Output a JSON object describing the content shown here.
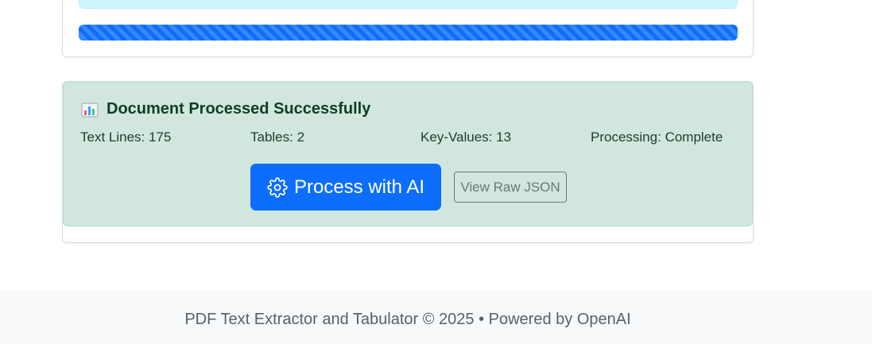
{
  "progress": {
    "percent": 100,
    "color": "#0d6efd"
  },
  "result": {
    "title_icon": "bar-chart-icon",
    "title": "Document Processed Successfully",
    "stats": [
      {
        "key": "Text Lines",
        "value": "175"
      },
      {
        "key": "Tables",
        "value": "2"
      },
      {
        "key": "Key-Values",
        "value": "13"
      },
      {
        "key": "Processing",
        "value": "Complete"
      }
    ],
    "process_button": {
      "icon": "gear-icon",
      "label": "Process with AI"
    },
    "raw_json_button": {
      "label": "View Raw JSON"
    }
  },
  "footer": {
    "text": "PDF Text Extractor and Tabulator © 2025 • Powered by OpenAI"
  },
  "colors": {
    "primary": "#0d6efd",
    "success_bg": "#d1e7dd",
    "info_bg": "#cff4fc",
    "footer_bg": "#f8f9fa"
  }
}
